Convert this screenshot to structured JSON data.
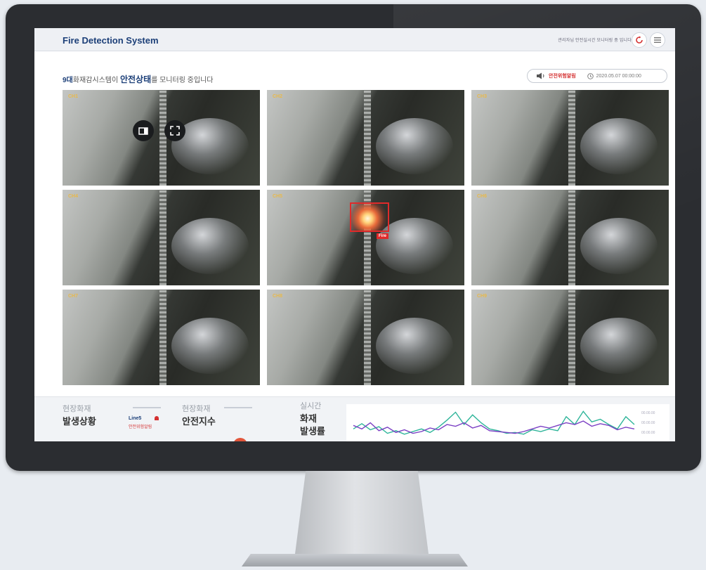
{
  "app": {
    "title": "Fire Detection System",
    "topbar_info": "관리자님 안전실시간 모니터링 중 입니다",
    "refresh_icon": "refresh-icon",
    "menu_icon": "menu-icon"
  },
  "heading": {
    "brand": "9대",
    "middle": "화재감시스템이 ",
    "state": "안전상태",
    "suffix": "를 모니터링 중입니다"
  },
  "status": {
    "text": "안전위험알림",
    "timestamp": "2020.05.07 00:00:00",
    "accent": "#d43030"
  },
  "cameras": [
    {
      "label": "CH1",
      "fire": false
    },
    {
      "label": "CH2",
      "fire": false
    },
    {
      "label": "CH3",
      "fire": false
    },
    {
      "label": "CH4",
      "fire": false
    },
    {
      "label": "CH5",
      "fire": true,
      "fire_tag": "Fire"
    },
    {
      "label": "CH6",
      "fire": false
    },
    {
      "label": "CH7",
      "fire": false
    },
    {
      "label": "CH8",
      "fire": false
    },
    {
      "label": "CH9",
      "fire": false
    }
  ],
  "overlay_controls": [
    {
      "icon": "single-view-icon"
    },
    {
      "icon": "fullscreen-icon"
    }
  ],
  "bottom": {
    "occurrence_sub": "현장화재",
    "occurrence_main": "발생상황",
    "line_label": "Line5",
    "line_status": "안전위험알림",
    "safety_sub": "현장화재",
    "safety_main": "안전지수",
    "rate_sub": "실시간",
    "rate_main1": "화재",
    "rate_main2": "발생률"
  },
  "chart_data": {
    "type": "line",
    "series": [
      {
        "color": "#2fb59a",
        "values": [
          30,
          42,
          28,
          35,
          20,
          26,
          18,
          24,
          30,
          22,
          34,
          50,
          68,
          40,
          62,
          44,
          30,
          26,
          20,
          22,
          18,
          28,
          24,
          30,
          26,
          58,
          40,
          70,
          46,
          52,
          40,
          30,
          58,
          40
        ]
      },
      {
        "color": "#7b3fc4",
        "values": [
          38,
          30,
          44,
          26,
          34,
          22,
          28,
          20,
          24,
          32,
          28,
          40,
          36,
          44,
          32,
          38,
          26,
          24,
          22,
          20,
          24,
          30,
          36,
          32,
          38,
          44,
          40,
          48,
          36,
          42,
          38,
          28,
          34,
          30
        ]
      }
    ],
    "ylim": [
      0,
      80
    ],
    "tick_labels": [
      "00.00.00",
      "00.00.00",
      "00.00.00"
    ]
  }
}
